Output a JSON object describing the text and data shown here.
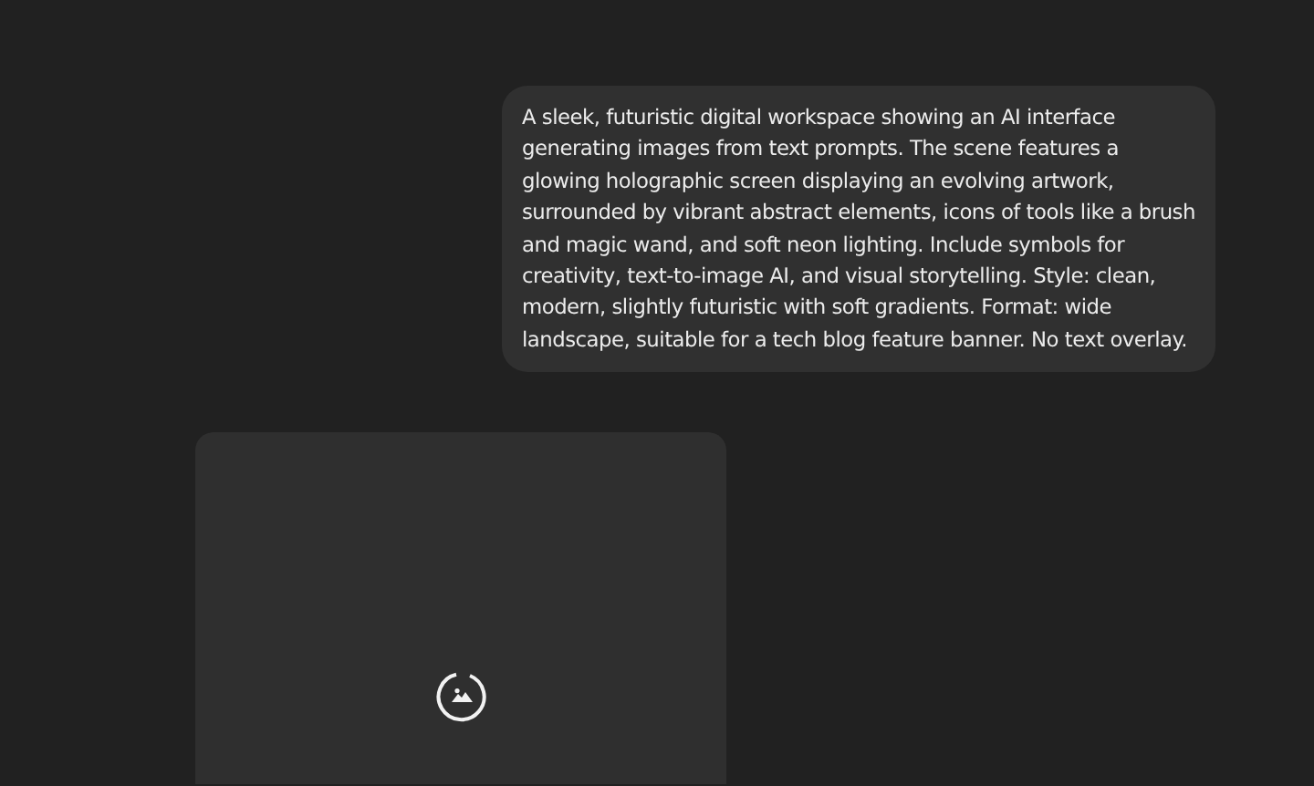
{
  "user_message": {
    "text": "A sleek, futuristic digital workspace showing an AI interface generating images from text prompts. The scene features a glowing holographic screen displaying an evolving artwork, surrounded by vibrant abstract elements, icons of tools like a brush and magic wand, and soft neon lighting. Include symbols for creativity, text-to-image AI, and visual storytelling. Style: clean, modern, slightly futuristic with soft gradients. Format: wide landscape, suitable for a tech blog feature banner. No text overlay."
  },
  "image_result": {
    "loading": true
  }
}
